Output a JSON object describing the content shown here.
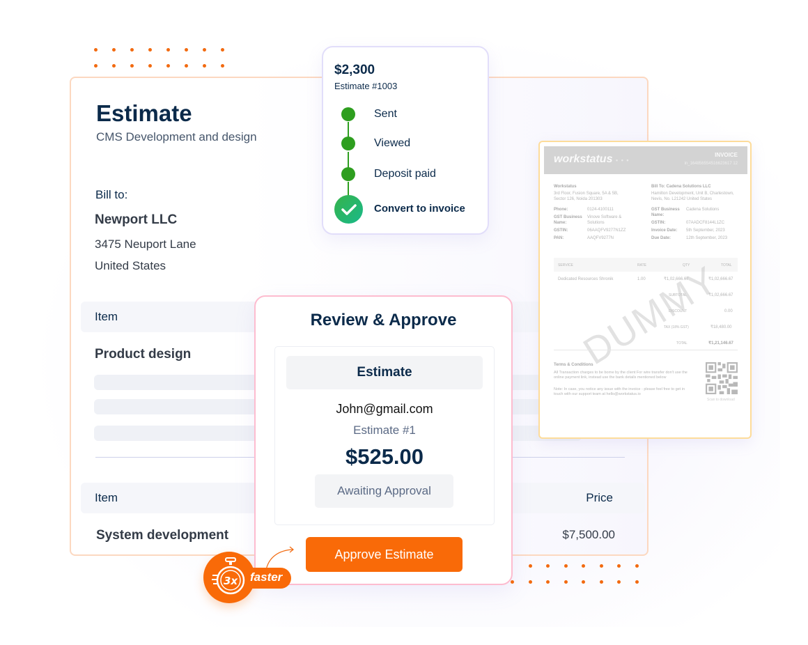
{
  "colors": {
    "accent": "#f96a08",
    "navy": "#0b2a4a",
    "success": "#2e9e1f"
  },
  "estimate": {
    "title": "Estimate",
    "subtitle": "CMS Development and design",
    "bill_to_label": "Bill to:",
    "company": "Newport LLC",
    "address_line1": "3475 Neuport Lane",
    "address_line2": "United States",
    "table1": {
      "header_item": "Item",
      "row_item": "Product design"
    },
    "table2": {
      "header_item": "Item",
      "header_price": "Price",
      "row_item": "System development",
      "row_price": "$7,500.00"
    }
  },
  "timeline": {
    "amount": "$2,300",
    "estimate_number": "Estimate #1003",
    "steps": [
      {
        "label": "Sent",
        "status": "done"
      },
      {
        "label": "Viewed",
        "status": "done"
      },
      {
        "label": "Deposit paid",
        "status": "done"
      }
    ],
    "final_step": "Convert to invoice",
    "final_icon": "check-icon"
  },
  "invoice": {
    "brand": "workstatus",
    "brand_dots": "• • •",
    "title": "INVOICE",
    "id": "in_164856554516623617 12",
    "from": {
      "name": "Workstatus",
      "address": [
        "3rd Floor, Fusion Square, 5A & 5B,",
        "Sector 126, Noida 201303"
      ],
      "fields": [
        {
          "label": "Phone:",
          "value": "0124-4100111"
        },
        {
          "label": "GST Business Name:",
          "value": "Vinove Software & Solutions"
        },
        {
          "label": "GSTIN:",
          "value": "06AAQFV9277N1ZZ"
        },
        {
          "label": "PAN:",
          "value": "AAQFV9277N"
        }
      ]
    },
    "to": {
      "name": "Bill To: Cadena Solutions LLC",
      "address": [
        "Hamilton Development, Unit B, Charlestown,",
        "Nevis, No. L21242 United States"
      ],
      "fields": [
        {
          "label": "GST Business Name:",
          "value": "Cadena Solutions"
        },
        {
          "label": "GSTIN:",
          "value": "07AADCF8144L1ZC"
        },
        {
          "label": "Invoice Date:",
          "value": "5th September, 2023"
        },
        {
          "label": "Due Date:",
          "value": "12th September, 2023"
        }
      ]
    },
    "table_headers": [
      "SERVICE",
      "RATE",
      "QTY",
      "TOTAL"
    ],
    "row": {
      "service": "Dedicated Resources Shronik",
      "rate": "1.00",
      "qty": "₹1,02,666.67",
      "total": "₹1,02,666.67"
    },
    "summary": [
      {
        "label": "SUBTOTAL",
        "value": "₹1,02,666.67"
      },
      {
        "label": "DISCOUNT",
        "value": "0.00"
      },
      {
        "label": "TAX (18% GST)",
        "value": "₹18,480.00"
      },
      {
        "label": "TOTAL",
        "value": "₹1,21,146.67"
      }
    ],
    "watermark": "DUMMY",
    "terms_title": "Terms & Conditions",
    "terms_text": "All Transaction charges to be borne by the client For wire transfer don't use the online payment link, instead use the bank details mentioned below",
    "note_text": "Note: In case, you notice any issue with the invoice - please feel free to get in touch with our support team at hello@workstatus.io",
    "qr_caption": "Scan to download"
  },
  "review": {
    "title": "Review & Approve",
    "tab_label": "Estimate",
    "email": "John@gmail.com",
    "estimate_number": "Estimate #1",
    "amount": "$525.00",
    "status": "Awaiting Approval",
    "approve_button": "Approve Estimate"
  },
  "badge": {
    "multiplier": "3x",
    "label": "faster",
    "icon": "stopwatch-icon"
  }
}
